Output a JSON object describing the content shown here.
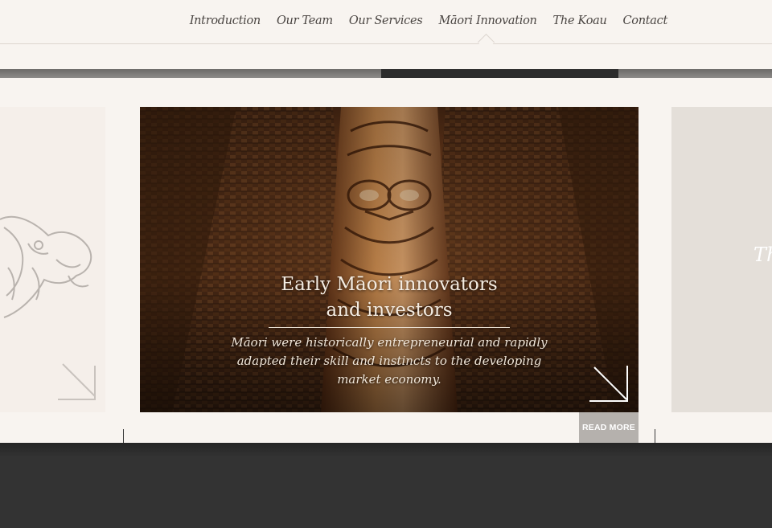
{
  "nav": {
    "items": [
      {
        "label": "Introduction"
      },
      {
        "label": "Our Team"
      },
      {
        "label": "Our Services"
      },
      {
        "label": "Māori Innovation",
        "active": true
      },
      {
        "label": "The Koau"
      },
      {
        "label": "Contact"
      }
    ]
  },
  "slide": {
    "title_line1": "Early Māori innovators",
    "title_line2": "and investors",
    "description": "Māori were historically entrepreneurial and rapidly adapted their skill and instincts to the developing market economy.",
    "read_more_label": "READ MORE"
  },
  "next_slide": {
    "title_fragment": "Th"
  },
  "colors": {
    "background": "#f8f4f0",
    "footer": "#333333",
    "read_more_bg": "#b5b1ad",
    "nav_text": "#4a4542"
  }
}
